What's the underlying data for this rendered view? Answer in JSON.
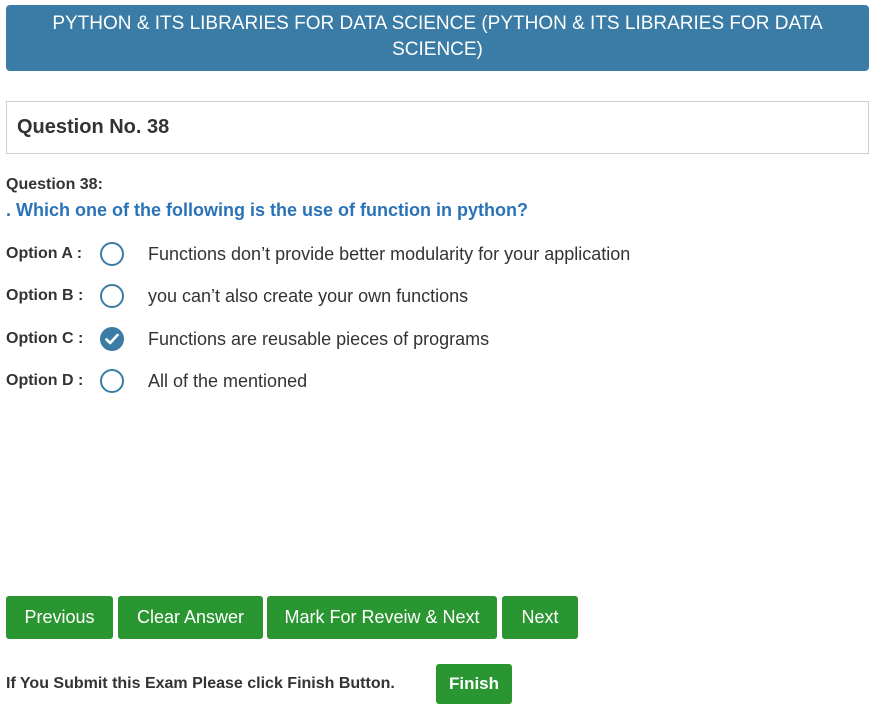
{
  "header": {
    "title": "PYTHON & ITS LIBRARIES FOR DATA SCIENCE (PYTHON & ITS LIBRARIES FOR DATA SCIENCE)"
  },
  "question": {
    "number_title": "Question No. 38",
    "label": "Question 38:",
    "text": ". Which one of the following is the use of function in python?"
  },
  "options": [
    {
      "label": "Option A :",
      "text": "Functions don’t provide better modularity for your application",
      "selected": false
    },
    {
      "label": "Option B :",
      "text": "you can’t also create your own functions",
      "selected": false
    },
    {
      "label": "Option C :",
      "text": "Functions are reusable pieces of programs",
      "selected": true
    },
    {
      "label": "Option D :",
      "text": "All of the mentioned",
      "selected": false
    }
  ],
  "buttons": {
    "previous": "Previous",
    "clear": "Clear Answer",
    "mark_review": "Mark For Reveiw & Next",
    "next": "Next"
  },
  "finish": {
    "note": "If You Submit this Exam Please click Finish Button.",
    "button": "Finish"
  },
  "colors": {
    "header_bg": "#3a7ca5",
    "button_green": "#2a9632",
    "question_blue": "#2a73b8"
  }
}
